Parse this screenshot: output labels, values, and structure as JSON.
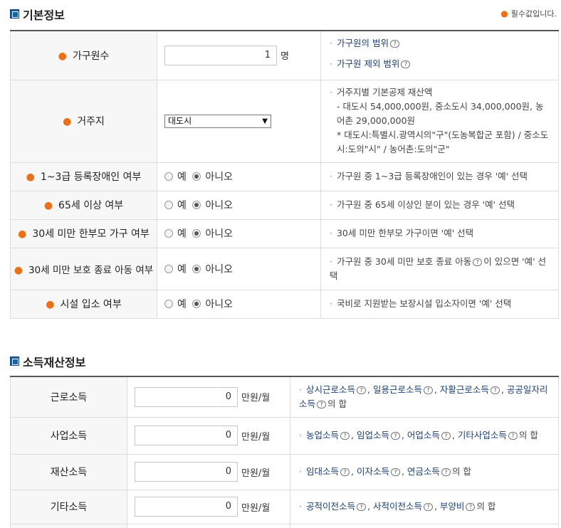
{
  "basic": {
    "title": "기본정보",
    "required_note": "필수값입니다.",
    "household": {
      "label": "가구원수",
      "value": "1",
      "unit": "명",
      "links": [
        "가구원의 범위",
        "가구원 제외 범위"
      ]
    },
    "residence": {
      "label": "거주지",
      "selected": "대도시",
      "desc": [
        "거주지별 기본공제 재산액",
        "- 대도시 54,000,000원, 중소도시 34,000,000원, 농어촌 29,000,000원",
        "* 대도시:특별시.광역시의\"구\"(도농복합군 포함) / 중소도시:도의\"시\" / 농어촌:도의\"군\""
      ]
    },
    "yes_label": "예",
    "no_label": "아니오",
    "questions": [
      {
        "label": "1~3급 등록장애인 여부",
        "selected": "no",
        "desc": "가구원 중 1~3급 등록장애인이 있는 경우 '예' 선택"
      },
      {
        "label": "65세 이상 여부",
        "selected": "no",
        "desc": "가구원 중 65세 이상인 분이 있는 경우 '예' 선택"
      },
      {
        "label": "30세 미만 한부모 가구 여부",
        "selected": "no",
        "desc": "30세 미만 한부모 가구이면 '예' 선택"
      },
      {
        "label": "30세 미만 보호 종료 아동 여부",
        "selected": "no",
        "desc_pre": "가구원 중 30세 미만 보호 종료 아동",
        "desc_post": "이 있으면 '예' 선택"
      },
      {
        "label": "시설 입소 여부",
        "selected": "no",
        "desc": "국비로 지원받는 보장시설 입소자이면 '예' 선택"
      }
    ]
  },
  "income": {
    "title": "소득재산정보",
    "unit": "만원/월",
    "rows": [
      {
        "label": "근로소득",
        "value": "0",
        "items": [
          "상시근로소득",
          "일용근로소득",
          "자활근로소득",
          "공공일자리소득"
        ],
        "suffix": "의 합"
      },
      {
        "label": "사업소득",
        "value": "0",
        "items": [
          "농업소득",
          "임업소득",
          "어업소득",
          "기타사업소득"
        ],
        "suffix": "의 합"
      },
      {
        "label": "재산소득",
        "value": "0",
        "items": [
          "임대소득",
          "이자소득",
          "연금소득"
        ],
        "suffix": "의 합"
      },
      {
        "label": "기타소득",
        "value": "0",
        "items": [
          "공적이전소득",
          "사적이전소득",
          "부양비"
        ],
        "suffix": "의 합"
      }
    ]
  },
  "icons": {
    "help": "question-bubble-icon",
    "section": "square-bullet-icon",
    "required": "orange-dot-icon"
  }
}
